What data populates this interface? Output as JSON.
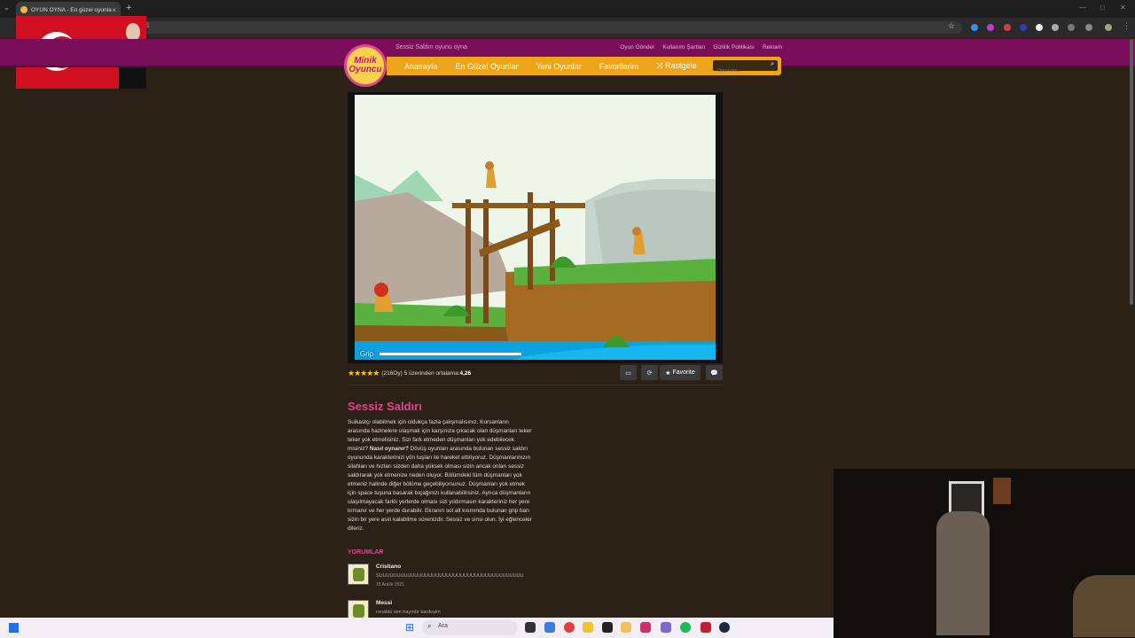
{
  "browser": {
    "tab_title": "OYUN OYNA - En güzel oyunlar",
    "tab_close": "×",
    "new_tab": "+",
    "address": "ß",
    "accent": "#1f1f1f"
  },
  "site": {
    "logo_line1": "Minik",
    "logo_line2": "Oyuncu",
    "tagline": "Sessiz Saldırı oyunu oyna",
    "top_links": [
      "Oyun Gönder",
      "Kullanım Şartları",
      "Gizlilik Politikası",
      "Reklam"
    ],
    "nav": [
      "Anasayfa",
      "En Güzel Oyunlar",
      "Yeni Oyunlar",
      "Favorilerim",
      "Rastgele"
    ],
    "search_placeholder": "Oyun ara...",
    "brand_color": "#e0458f",
    "header_color": "#7a0d5a",
    "nav_color": "#efa51a"
  },
  "game": {
    "hud_label": "Grip",
    "grip_level": 0.85
  },
  "rating": {
    "stars_text": "★★★★★",
    "votes": "(216",
    "text_mid": " Oy) 5 üzerinden ortalama: ",
    "average": "4,26"
  },
  "controls": {
    "favorite_label": "Favorite"
  },
  "content": {
    "title": "Sessiz Saldırı",
    "desc_part1": "Suikastçı olabilmek için oldukça fazla çalışmalısınız. Korsanların arasında hazinelere ulaşmak için karşınıza çıkacak olan düşmanları teker teker yok etmelisiniz. Sizi fark etmeden düşmanları yok edebilecek misiniz? ",
    "desc_bold": "Nasıl oynanır?",
    "desc_part2": " Dövüş oyunları arasında bulunan sessiz saldırı oyununda karakterinizi yön tuşları ile hareket ettiriyoruz. Düşmanlarınızın silahları ve hızları sizden daha yüksek olması sizin ancak onları sessiz saldırarak yok etmenize neden oluyor. Bölümdeki tüm düşmanları yok etmeniz halinde diğer bölüme geçebiliyorsunuz. Düşmanları yok etmek için space tuşuna basarak bıçağınızı kullanabilirsiniz. Ayrıca düşmanların ulaşılmayacak farklı yerlerde olması sizi yıldırmasın karakteriniz her yere tırmanır ve her yerde durabilir. Ekranın sol alt kısmında bulunan grip barı sizin bir yere asılı kalabilme sürenizdir. Sessiz ve sinsi olun. İyi eğlenceler dileriz.",
    "comments_heading": "YORUMLAR",
    "comments": [
      {
        "name": "Cristiano",
        "text": "SUUUUUUUUUUUUUUUUUUUUUUUUUUUUUUUUUUUUUUUUU",
        "date": "15 Aralık 2021"
      },
      {
        "name": "Messi",
        "text": "ronaldo sen hayırdır kardeşim",
        "date": ""
      }
    ]
  },
  "taskbar": {
    "search_label": "Ara"
  }
}
